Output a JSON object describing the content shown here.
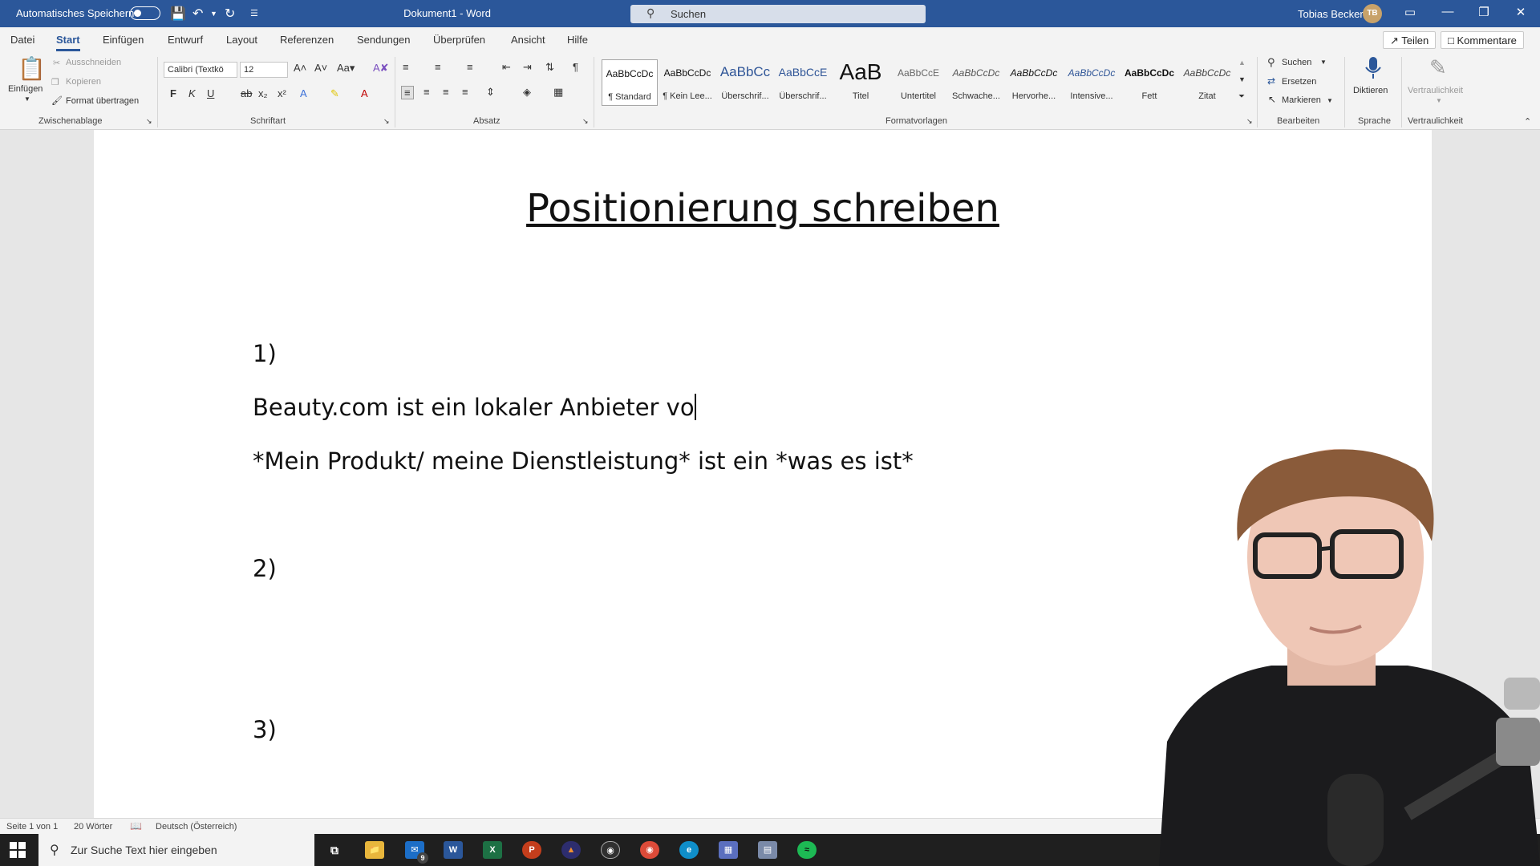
{
  "titlebar": {
    "autosave_label": "Automatisches Speichern",
    "document_title": "Dokument1  -  Word",
    "search_label": "Suchen",
    "user_name": "Tobias Becker",
    "user_initials": "TB"
  },
  "tabs": [
    "Datei",
    "Start",
    "Einfügen",
    "Entwurf",
    "Layout",
    "Referenzen",
    "Sendungen",
    "Überprüfen",
    "Ansicht",
    "Hilfe"
  ],
  "active_tab": "Start",
  "top_actions": {
    "share": "Teilen",
    "comments": "Kommentare"
  },
  "ribbon": {
    "clipboard": {
      "paste": "Einfügen",
      "cut": "Ausschneiden",
      "copy": "Kopieren",
      "format_painter": "Format übertragen",
      "label": "Zwischenablage"
    },
    "font": {
      "font_name": "Calibri (Textkö",
      "font_size": "12",
      "bold": "F",
      "italic": "K",
      "underline": "U",
      "label": "Schriftart"
    },
    "paragraph": {
      "label": "Absatz"
    },
    "styles": {
      "label": "Formatvorlagen",
      "items": [
        {
          "preview": "AaBbCcDc",
          "name": "¶ Standard"
        },
        {
          "preview": "AaBbCcDc",
          "name": "¶ Kein Lee..."
        },
        {
          "preview": "AaBbCc",
          "name": "Überschrif..."
        },
        {
          "preview": "AaBbCcE",
          "name": "Überschrif..."
        },
        {
          "preview": "AaB",
          "name": "Titel"
        },
        {
          "preview": "AaBbCcE",
          "name": "Untertitel"
        },
        {
          "preview": "AaBbCcDc",
          "name": "Schwache..."
        },
        {
          "preview": "AaBbCcDc",
          "name": "Hervorhe..."
        },
        {
          "preview": "AaBbCcDc",
          "name": "Intensive..."
        },
        {
          "preview": "AaBbCcDc",
          "name": "Fett"
        },
        {
          "preview": "AaBbCcDc",
          "name": "Zitat"
        }
      ]
    },
    "editing": {
      "find": "Suchen",
      "replace": "Ersetzen",
      "select": "Markieren",
      "label": "Bearbeiten"
    },
    "voice": {
      "dictate": "Diktieren",
      "label": "Sprache"
    },
    "sensitivity": {
      "button": "Vertraulichkeit",
      "label": "Vertraulichkeit"
    }
  },
  "document": {
    "heading": "Positionierung schreiben",
    "item1": "1)",
    "line1": "Beauty.com ist ein lokaler Anbieter vo",
    "line2": "*Mein Produkt/ meine Dienstleistung* ist ein *was es ist*",
    "item2": "2)",
    "item3": "3)"
  },
  "statusbar": {
    "page": "Seite 1 von 1",
    "words": "20 Wörter",
    "language": "Deutsch (Österreich)"
  },
  "taskbar": {
    "search_placeholder": "Zur Suche Text hier eingeben",
    "mail_badge": "9"
  }
}
